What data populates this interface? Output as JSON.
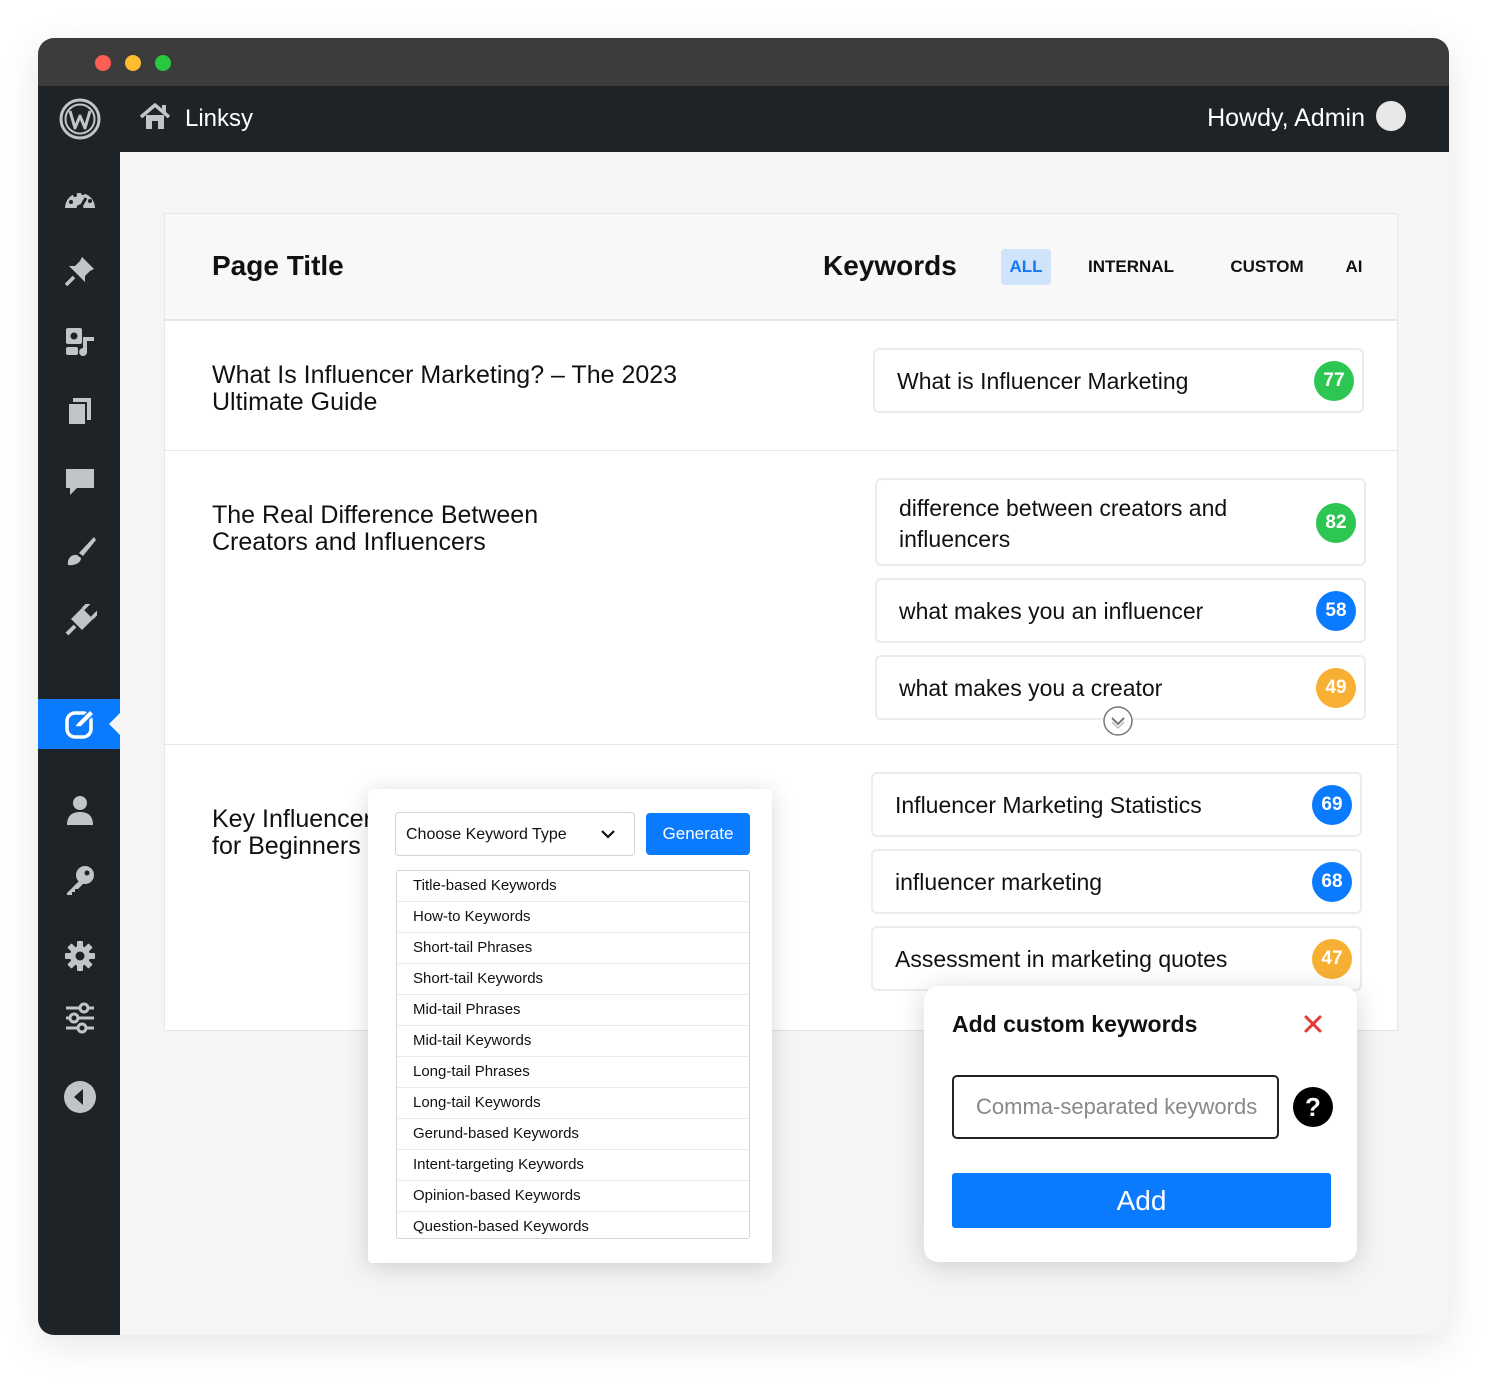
{
  "app": {
    "site_name": "Linksy",
    "howdy": "Howdy, Admin"
  },
  "sidebar": {
    "items": [
      {
        "icon": "dashboard-icon"
      },
      {
        "icon": "pin-icon"
      },
      {
        "icon": "media-icon"
      },
      {
        "icon": "pages-icon"
      },
      {
        "icon": "comments-icon"
      },
      {
        "icon": "brush-icon"
      },
      {
        "icon": "plugins-icon"
      },
      {
        "icon": "linksy-icon",
        "active": true
      },
      {
        "icon": "users-icon"
      },
      {
        "icon": "key-icon"
      },
      {
        "icon": "settings-icon"
      },
      {
        "icon": "sliders-icon"
      },
      {
        "icon": "collapse-icon"
      }
    ]
  },
  "table": {
    "col_page_title": "Page Title",
    "col_keywords": "Keywords",
    "tabs": [
      "ALL",
      "INTERNAL",
      "CUSTOM",
      "AI"
    ],
    "active_tab": "ALL",
    "rows": [
      {
        "title_lines": [
          "What Is Influencer Marketing? – The 2023",
          "Ultimate Guide"
        ],
        "keywords": [
          {
            "text": "What is Influencer Marketing",
            "score": "77",
            "color": "#2dc653"
          }
        ]
      },
      {
        "title_lines": [
          "The Real Difference Between",
          "Creators and Influencers"
        ],
        "keywords": [
          {
            "text_lines": [
              "difference between creators and",
              "influencers"
            ],
            "score": "82",
            "color": "#2dc653"
          },
          {
            "text": "what makes you an influencer",
            "score": "58",
            "color": "#0a7aff"
          },
          {
            "text": "what makes you a creator",
            "score": "49",
            "color": "#f8b034"
          }
        ]
      },
      {
        "title_lines": [
          "Key Influencer",
          "for Beginners"
        ],
        "keywords": [
          {
            "text": "Influencer Marketing Statistics",
            "score": "69",
            "color": "#0a7aff"
          },
          {
            "text": "influencer marketing",
            "score": "68",
            "color": "#0a7aff"
          },
          {
            "text": "Assessment in marketing quotes",
            "score": "47",
            "color": "#f8b034"
          }
        ]
      }
    ]
  },
  "generator": {
    "select_label": "Choose Keyword Type",
    "generate_label": "Generate",
    "options": [
      "Title-based Keywords",
      "How-to Keywords",
      "Short-tail Phrases",
      "Short-tail Keywords",
      "Mid-tail Phrases",
      "Mid-tail Keywords",
      "Long-tail Phrases",
      "Long-tail Keywords",
      "Gerund-based Keywords",
      "Intent-targeting Keywords",
      "Opinion-based Keywords",
      "Question-based Keywords"
    ]
  },
  "custom": {
    "title": "Add custom keywords",
    "placeholder": "Comma-separated keywords",
    "help": "?",
    "add_label": "Add"
  },
  "colors": {
    "accent": "#0a7aff",
    "green": "#2dc653",
    "orange": "#f8b034",
    "admin_bg": "#1e2327",
    "close": "#e53935"
  }
}
